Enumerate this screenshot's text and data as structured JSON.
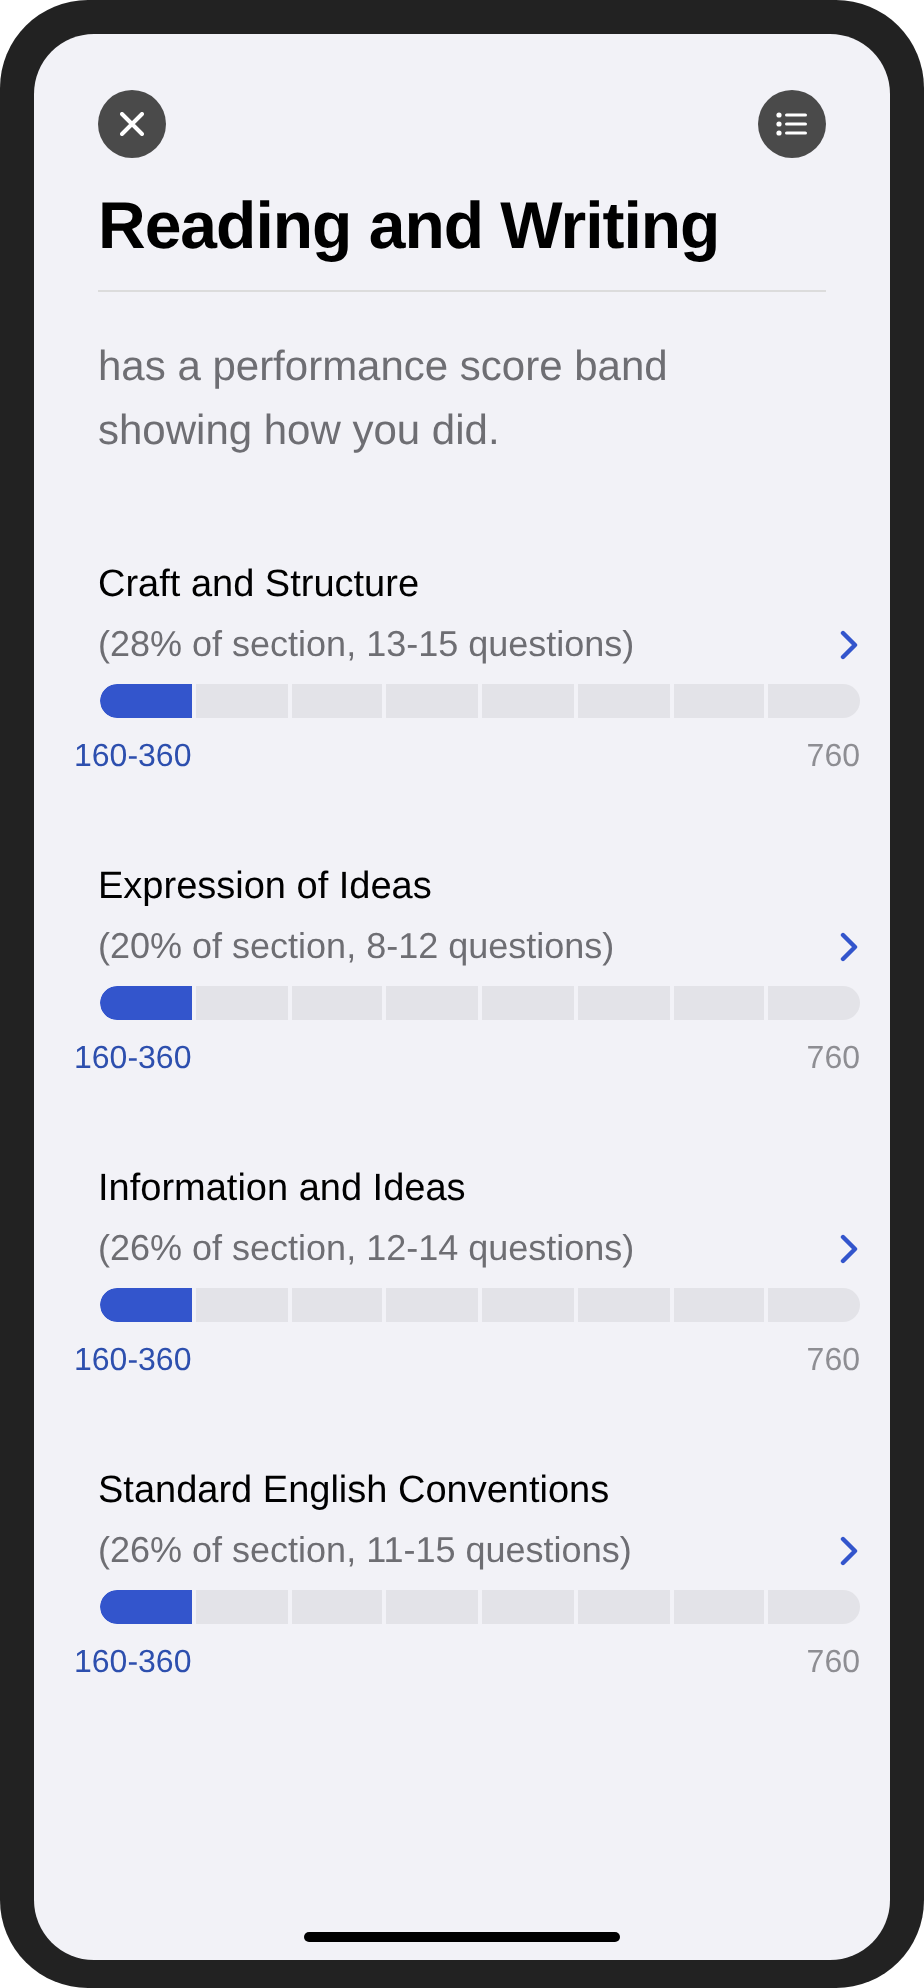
{
  "title": "Reading and Writing",
  "intro": "has a performance score band showing how you did.",
  "domains": [
    {
      "name": "Craft and Structure",
      "detail": "(28% of section, 13-15 questions)",
      "level": 0.125,
      "range": "160-360",
      "max": "760"
    },
    {
      "name": "Expression of Ideas",
      "detail": "(20% of section, 8-12 questions)",
      "level": 0.125,
      "range": "160-360",
      "max": "760"
    },
    {
      "name": "Information and Ideas",
      "detail": "(26% of section, 12-14 questions)",
      "level": 0.125,
      "range": "160-360",
      "max": "760"
    },
    {
      "name": "Standard English Conventions",
      "detail": "(26% of section, 11-15 questions)",
      "level": 0.125,
      "range": "160-360",
      "max": "760"
    }
  ]
}
